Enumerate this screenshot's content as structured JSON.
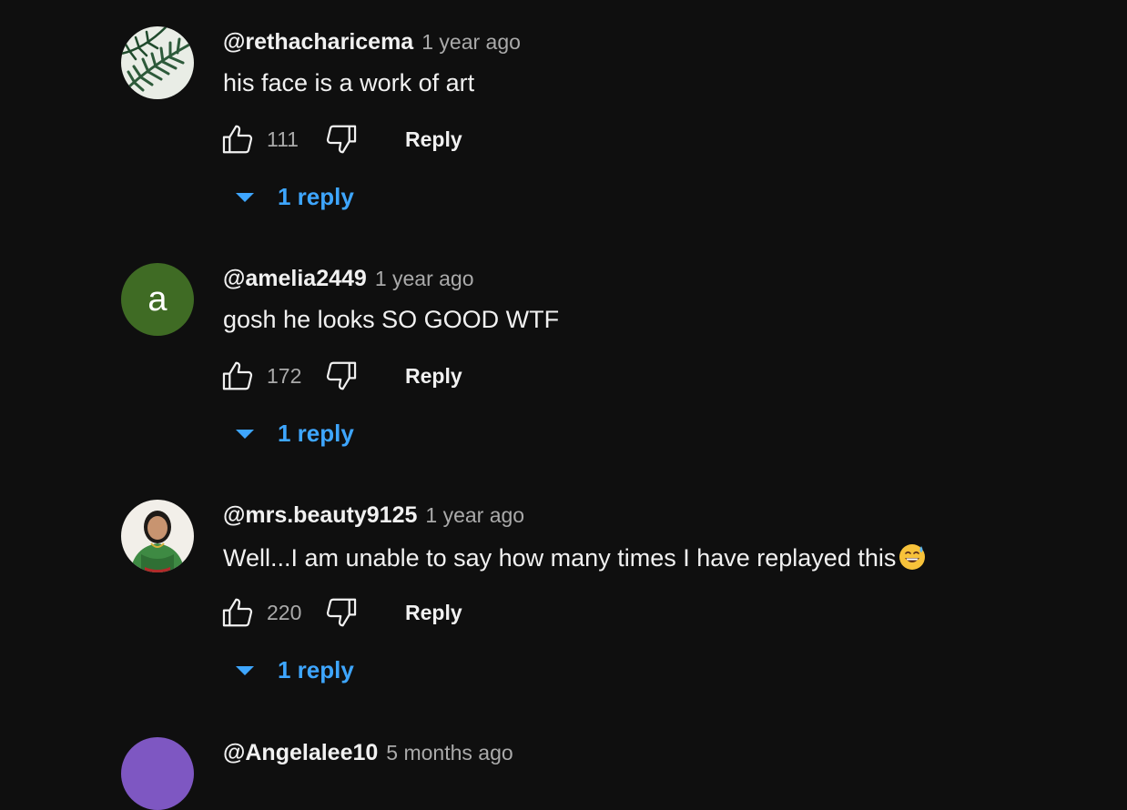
{
  "comments": [
    {
      "author": "@rethacharicema",
      "time": "1 year ago",
      "text": "his face is a work of art",
      "likes": "111",
      "reply_label": "Reply",
      "replies_label": "1 reply",
      "avatar_type": "leaf-image"
    },
    {
      "author": "@amelia2449",
      "time": "1 year ago",
      "text": "gosh he looks SO GOOD WTF",
      "likes": "172",
      "reply_label": "Reply",
      "replies_label": "1 reply",
      "avatar_type": "letter",
      "avatar_letter": "a",
      "avatar_color": "#3f6b24"
    },
    {
      "author": "@mrs.beauty9125",
      "time": "1 year ago",
      "text": "Well...I am unable to say how many times I have replayed this",
      "emoji": "grinning-sweat-emoji",
      "likes": "220",
      "reply_label": "Reply",
      "replies_label": "1 reply",
      "avatar_type": "portrait-photo"
    },
    {
      "author": "@Angelalee10",
      "time": "5 months ago",
      "avatar_type": "color",
      "avatar_color": "#7e57c2"
    }
  ],
  "colors": {
    "background": "#0f0f0f",
    "primary_text": "#f1f1f1",
    "secondary_text": "#aaaaaa",
    "link_blue": "#3ea6ff"
  },
  "icons": {
    "like": "thumbs-up-icon",
    "dislike": "thumbs-down-icon",
    "expand": "caret-down-icon"
  }
}
